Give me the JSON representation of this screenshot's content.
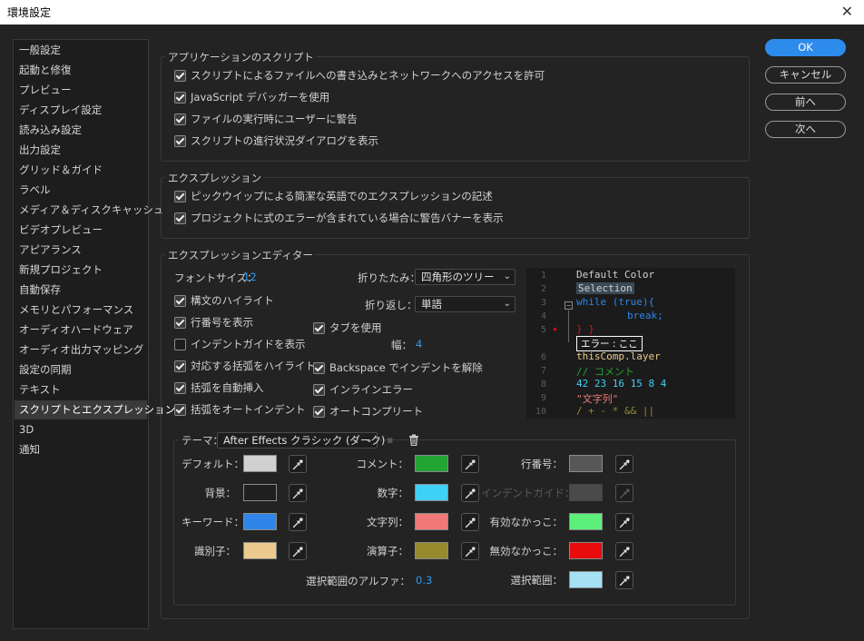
{
  "window": {
    "title": "環境設定"
  },
  "sidebar": {
    "items": [
      {
        "label": "一般設定"
      },
      {
        "label": "起動と修復"
      },
      {
        "label": "プレビュー"
      },
      {
        "label": "ディスプレイ設定"
      },
      {
        "label": "読み込み設定"
      },
      {
        "label": "出力設定"
      },
      {
        "label": "グリッド＆ガイド"
      },
      {
        "label": "ラベル"
      },
      {
        "label": "メディア＆ディスクキャッシュ"
      },
      {
        "label": "ビデオプレビュー"
      },
      {
        "label": "アピアランス"
      },
      {
        "label": "新規プロジェクト"
      },
      {
        "label": "自動保存"
      },
      {
        "label": "メモリとパフォーマンス"
      },
      {
        "label": "オーディオハードウェア"
      },
      {
        "label": "オーディオ出力マッピング"
      },
      {
        "label": "設定の同期"
      },
      {
        "label": "テキスト"
      },
      {
        "label": "スクリプトとエクスプレッション",
        "selected": true
      },
      {
        "label": "3D"
      },
      {
        "label": "通知"
      }
    ]
  },
  "buttons": {
    "ok": "OK",
    "cancel": "キャンセル",
    "prev": "前へ",
    "next": "次へ"
  },
  "scripting": {
    "title": "アプリケーションのスクリプト",
    "options": [
      {
        "label": "スクリプトによるファイルへの書き込みとネットワークへのアクセスを許可",
        "checked": true
      },
      {
        "label": "JavaScript デバッガーを使用",
        "checked": true
      },
      {
        "label": "ファイルの実行時にユーザーに警告",
        "checked": true
      },
      {
        "label": "スクリプトの進行状況ダイアログを表示",
        "checked": true
      }
    ]
  },
  "expressions": {
    "title": "エクスプレッション",
    "options": [
      {
        "label": "ピックウイップによる簡潔な英語でのエクスプレッションの記述",
        "checked": true
      },
      {
        "label": "プロジェクトに式のエラーが含まれている場合に警告バナーを表示",
        "checked": true
      }
    ]
  },
  "editor": {
    "title": "エクスプレッションエディター",
    "font_size_label": "フォントサイズ：",
    "font_size_value": "12",
    "fold_label": "折りたたみ：",
    "fold_value": "四角形のツリー",
    "wrap_label": "折り返し：",
    "wrap_value": "単語",
    "tab_width_label": "幅：",
    "tab_width_value": "4",
    "left_options": [
      {
        "label": "構文のハイライト",
        "checked": true
      },
      {
        "label": "行番号を表示",
        "checked": true
      },
      {
        "label": "インデントガイドを表示",
        "checked": false
      },
      {
        "label": "対応する括弧をハイライト",
        "checked": true
      },
      {
        "label": "括弧を自動挿入",
        "checked": true
      },
      {
        "label": "括弧をオートインデント",
        "checked": true
      }
    ],
    "right_options": [
      {
        "label": "タブを使用",
        "checked": true
      },
      {
        "label": "Backspace でインデントを解除",
        "checked": true
      },
      {
        "label": "インラインエラー",
        "checked": true
      },
      {
        "label": "オートコンプリート",
        "checked": true
      }
    ],
    "preview": {
      "line_numbers": [
        "1",
        "2",
        "3",
        "4",
        "5",
        "6",
        "7",
        "8",
        "9",
        "10"
      ],
      "lines": [
        "Default Color",
        "Selection",
        "while (true){",
        "break;",
        "} }",
        "エラー : ここ",
        "thisComp.layer",
        "// コメント",
        "42 23 16 15 8 4",
        "\"文字列\"",
        "/ + - * && ||"
      ]
    }
  },
  "theme": {
    "label": "テーマ：",
    "value": "After Effects クラシック (ダーク)",
    "colors": [
      {
        "label": "デフォルト：",
        "color": "#d0d0d0",
        "enabled": true
      },
      {
        "label": "背景：",
        "color": "#1f1f1f",
        "enabled": true
      },
      {
        "label": "キーワード：",
        "color": "#2f86e8",
        "enabled": true
      },
      {
        "label": "識別子：",
        "color": "#ecc98e",
        "enabled": true
      },
      {
        "label": "コメント：",
        "color": "#24a432",
        "enabled": true
      },
      {
        "label": "数字：",
        "color": "#3fd1f5",
        "enabled": true
      },
      {
        "label": "文字列：",
        "color": "#f07878",
        "enabled": true
      },
      {
        "label": "演算子：",
        "color": "#968a2e",
        "enabled": true
      },
      {
        "label": "行番号：",
        "color": "#575757",
        "enabled": true
      },
      {
        "label": "インデントガイド：",
        "color": "#4a4a4a",
        "enabled": false
      },
      {
        "label": "有効なかっこ：",
        "color": "#5cf07a",
        "enabled": true
      },
      {
        "label": "無効なかっこ：",
        "color": "#e80b0b",
        "enabled": true
      },
      {
        "label": "選択範囲：",
        "color": "#a5e0f3",
        "enabled": true
      }
    ],
    "selection_alpha_label": "選択範囲のアルファ：",
    "selection_alpha_value": "0.3"
  }
}
